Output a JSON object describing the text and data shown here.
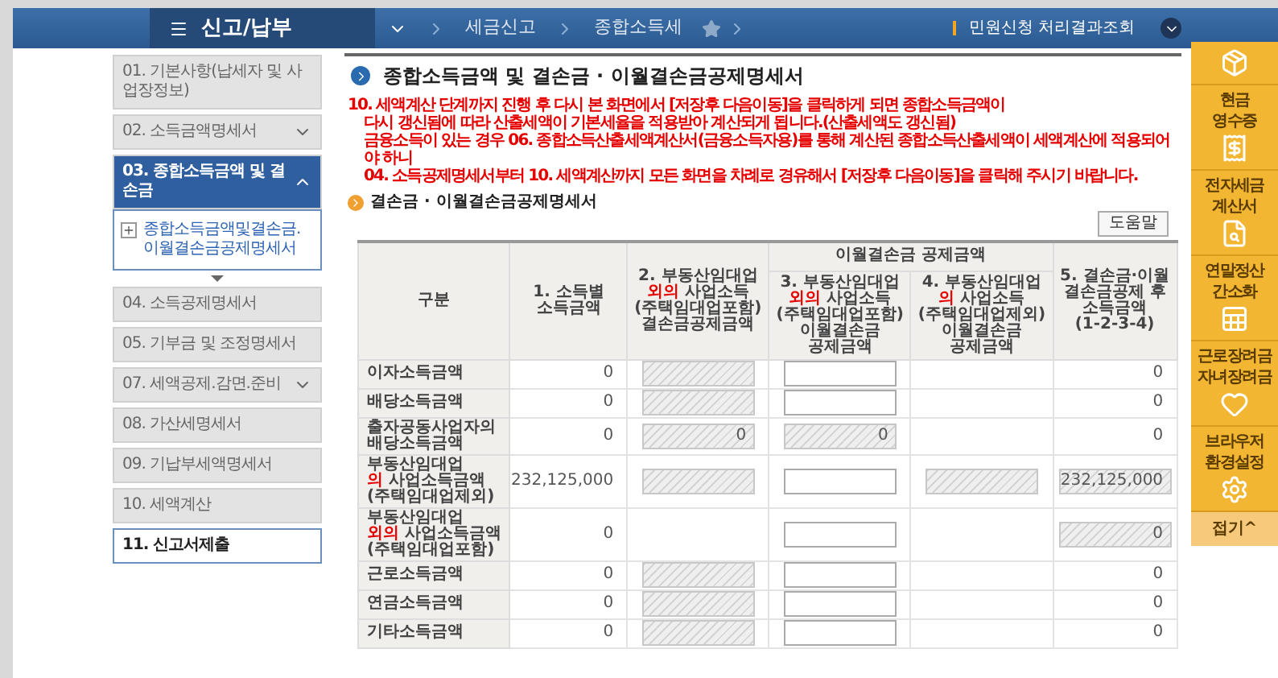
{
  "top_bar": {
    "menu_title": "신고/납부",
    "breadcrumbs": [
      "세금신고",
      "종합소득세"
    ],
    "favorite": false,
    "link": "민원신청 처리결과조회"
  },
  "nav": [
    {
      "label": "01. 기본사항(납세자 및 사업장정보)",
      "selected": false,
      "outlined": false,
      "toggle": false
    },
    {
      "label": "02. 소득금액명세서",
      "selected": false,
      "outlined": false,
      "toggle": true
    },
    {
      "label": "03. 종합소득금액 및 결손금",
      "selected": true,
      "outlined": false,
      "toggle": true,
      "children": [
        {
          "label": "종합소득금액및결손금.이월결손금공제명세서"
        }
      ]
    },
    {
      "label": "04. 소득공제명세서",
      "selected": false,
      "outlined": false,
      "toggle": false
    },
    {
      "label": "05. 기부금 및 조정명세서",
      "selected": false,
      "outlined": false,
      "toggle": false
    },
    {
      "label": "07. 세액공제.감면.준비",
      "selected": false,
      "outlined": false,
      "toggle": true
    },
    {
      "label": "08. 가산세명세서",
      "selected": false,
      "outlined": false,
      "toggle": false
    },
    {
      "label": "09. 기납부세액명세서",
      "selected": false,
      "outlined": false,
      "toggle": false
    },
    {
      "label": "10. 세액계산",
      "selected": false,
      "outlined": false,
      "toggle": false
    },
    {
      "label": "11. 신고서제출",
      "selected": false,
      "outlined": true,
      "toggle": false
    }
  ],
  "main": {
    "title": "종합소득금액 및 결손금 · 이월결손금공제명세서",
    "notice": [
      "10. 세액계산 단계까지 진행 후 다시 본 화면에서 [저장후 다음이동]을 클릭하게 되면 종합소득금액이",
      "다시 갱신됨에 따라 산출세액이 기본세율을 적용받아 계산되게 됩니다.(산출세액도 갱신됨)",
      "금융소득이 있는 경우 06. 종합소득산출세액계산서(금융소득자용)를 통해 계산된 종합소득산출세액이 세액계산에 적용되어야 하니",
      "04. 소득공제명세서부터 10. 세액계산까지 모든 화면을 차례로 경유해서 [저장후 다음이동]을 클릭해 주시기 바랍니다."
    ],
    "subtitle": "결손금 · 이월결손금공제명세서",
    "help_button": "도움말"
  },
  "table": {
    "corner": "구분",
    "group_label": "이월결손금 공제금액",
    "columns": [
      {
        "grouped": false,
        "lines": [
          [
            {
              "text": "1. 소득별",
              "red": false
            }
          ],
          [
            {
              "text": "소득금액",
              "red": false
            }
          ]
        ]
      },
      {
        "grouped": false,
        "lines": [
          [
            {
              "text": "2. 부동산임대업",
              "red": false
            }
          ],
          [
            {
              "text": "외의",
              "red": true
            },
            {
              "text": " 사업소득",
              "red": false
            }
          ],
          [
            {
              "text": "(주택임대업포함)",
              "red": false
            }
          ],
          [
            {
              "text": "결손금공제금액",
              "red": false
            }
          ]
        ]
      },
      {
        "grouped": true,
        "lines": [
          [
            {
              "text": "3. 부동산임대업",
              "red": false
            }
          ],
          [
            {
              "text": "외의",
              "red": true
            },
            {
              "text": " 사업소득",
              "red": false
            }
          ],
          [
            {
              "text": "(주택임대업포함)",
              "red": false
            }
          ],
          [
            {
              "text": "이월결손금",
              "red": false
            }
          ],
          [
            {
              "text": "공제금액",
              "red": false
            }
          ]
        ]
      },
      {
        "grouped": true,
        "lines": [
          [
            {
              "text": "4. 부동산임대업",
              "red": false
            }
          ],
          [
            {
              "text": "의",
              "red": true
            },
            {
              "text": " 사업소득",
              "red": false
            }
          ],
          [
            {
              "text": "(주택임대업제외)",
              "red": false
            }
          ],
          [
            {
              "text": "이월결손금",
              "red": false
            }
          ],
          [
            {
              "text": "공제금액",
              "red": false
            }
          ]
        ]
      },
      {
        "grouped": false,
        "lines": [
          [
            {
              "text": "5. 결손금·이월",
              "red": false
            }
          ],
          [
            {
              "text": "결손금공제 후",
              "red": false
            }
          ],
          [
            {
              "text": "소득금액",
              "red": false
            }
          ],
          [
            {
              "text": "(1-2-3-4)",
              "red": false
            }
          ]
        ]
      }
    ],
    "rows": [
      {
        "lines": [
          [
            {
              "text": "이자소득금액",
              "red": false
            }
          ]
        ],
        "cells": [
          {
            "kind": "text",
            "value": "0"
          },
          {
            "kind": "hatched"
          },
          {
            "kind": "input"
          },
          {
            "kind": "empty"
          },
          {
            "kind": "text",
            "value": "0"
          }
        ]
      },
      {
        "lines": [
          [
            {
              "text": "배당소득금액",
              "red": false
            }
          ]
        ],
        "cells": [
          {
            "kind": "text",
            "value": "0"
          },
          {
            "kind": "hatched"
          },
          {
            "kind": "input"
          },
          {
            "kind": "empty"
          },
          {
            "kind": "text",
            "value": "0"
          }
        ]
      },
      {
        "lines": [
          [
            {
              "text": "출자공동사업자의",
              "red": false
            }
          ],
          [
            {
              "text": "배당소득금액",
              "red": false
            }
          ]
        ],
        "cells": [
          {
            "kind": "text",
            "value": "0"
          },
          {
            "kind": "hatched",
            "value": "0"
          },
          {
            "kind": "hatched",
            "value": "0"
          },
          {
            "kind": "empty"
          },
          {
            "kind": "text",
            "value": "0"
          }
        ]
      },
      {
        "lines": [
          [
            {
              "text": "부동산임대업",
              "red": false
            }
          ],
          [
            {
              "text": "의",
              "red": true
            },
            {
              "text": " 사업소득금액",
              "red": false
            }
          ],
          [
            {
              "text": "(주택임대업제외)",
              "red": false
            }
          ]
        ],
        "cells": [
          {
            "kind": "text",
            "value": "232,125,000"
          },
          {
            "kind": "hatched"
          },
          {
            "kind": "input"
          },
          {
            "kind": "hatched"
          },
          {
            "kind": "hatched",
            "value": "232,125,000"
          }
        ]
      },
      {
        "lines": [
          [
            {
              "text": "부동산임대업",
              "red": false
            }
          ],
          [
            {
              "text": "외의",
              "red": true
            },
            {
              "text": " 사업소득금액",
              "red": false
            }
          ],
          [
            {
              "text": "(주택임대업포함)",
              "red": false
            }
          ]
        ],
        "cells": [
          {
            "kind": "text",
            "value": "0"
          },
          {
            "kind": "empty"
          },
          {
            "kind": "input"
          },
          {
            "kind": "empty"
          },
          {
            "kind": "hatched",
            "value": "0"
          }
        ]
      },
      {
        "lines": [
          [
            {
              "text": "근로소득금액",
              "red": false
            }
          ]
        ],
        "cells": [
          {
            "kind": "text",
            "value": "0"
          },
          {
            "kind": "hatched"
          },
          {
            "kind": "input"
          },
          {
            "kind": "empty"
          },
          {
            "kind": "text",
            "value": "0"
          }
        ]
      },
      {
        "lines": [
          [
            {
              "text": "연금소득금액",
              "red": false
            }
          ]
        ],
        "cells": [
          {
            "kind": "text",
            "value": "0"
          },
          {
            "kind": "hatched"
          },
          {
            "kind": "input"
          },
          {
            "kind": "empty"
          },
          {
            "kind": "text",
            "value": "0"
          }
        ]
      },
      {
        "lines": [
          [
            {
              "text": "기타소득금액",
              "red": false
            }
          ]
        ],
        "cells": [
          {
            "kind": "text",
            "value": "0"
          },
          {
            "kind": "hatched"
          },
          {
            "kind": "input"
          },
          {
            "kind": "empty"
          },
          {
            "kind": "text",
            "value": "0"
          }
        ]
      }
    ]
  },
  "quick_menu": {
    "items": [
      {
        "kind": "box"
      },
      {
        "kind": "receipt",
        "lines": [
          "현금",
          "영수증"
        ]
      },
      {
        "kind": "document",
        "lines": [
          "전자세금",
          "계산서"
        ]
      },
      {
        "kind": "sheet",
        "lines": [
          "연말정산",
          "간소화"
        ]
      },
      {
        "kind": "heart",
        "lines": [
          "근로장려금",
          "자녀장려금"
        ]
      },
      {
        "kind": "gear",
        "lines": [
          "브라우저",
          "환경설정"
        ]
      }
    ],
    "collapse": "접기^"
  }
}
